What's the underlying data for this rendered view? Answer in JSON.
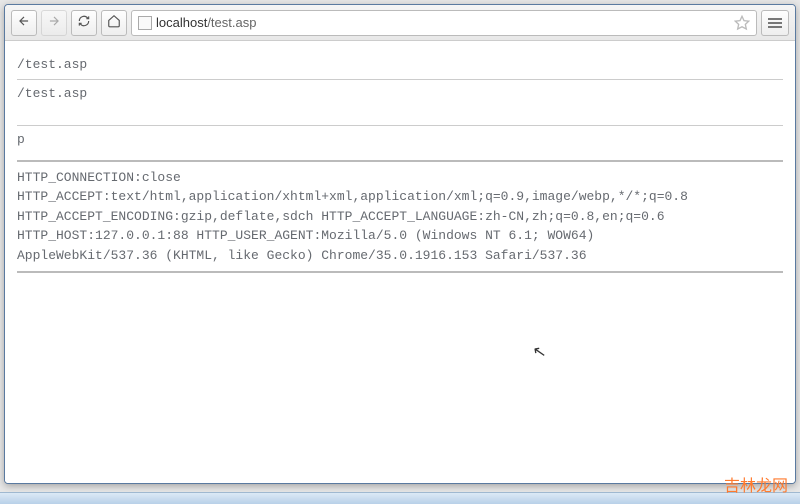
{
  "toolbar": {
    "url_display": "localhost/test.asp",
    "url_host": "localhost",
    "url_path": "/test.asp"
  },
  "content": {
    "line1": "/test.asp",
    "line2": "/test.asp",
    "line3": "p",
    "http_block": "HTTP_CONNECTION:close\nHTTP_ACCEPT:text/html,application/xhtml+xml,application/xml;q=0.9,image/webp,*/*;q=0.8\nHTTP_ACCEPT_ENCODING:gzip,deflate,sdch HTTP_ACCEPT_LANGUAGE:zh-CN,zh;q=0.8,en;q=0.6\nHTTP_HOST:127.0.0.1:88 HTTP_USER_AGENT:Mozilla/5.0 (Windows NT 6.1; WOW64)\nAppleWebKit/537.36 (KHTML, like Gecko) Chrome/35.0.1916.153 Safari/537.36"
  },
  "watermark": "吉林龙网"
}
